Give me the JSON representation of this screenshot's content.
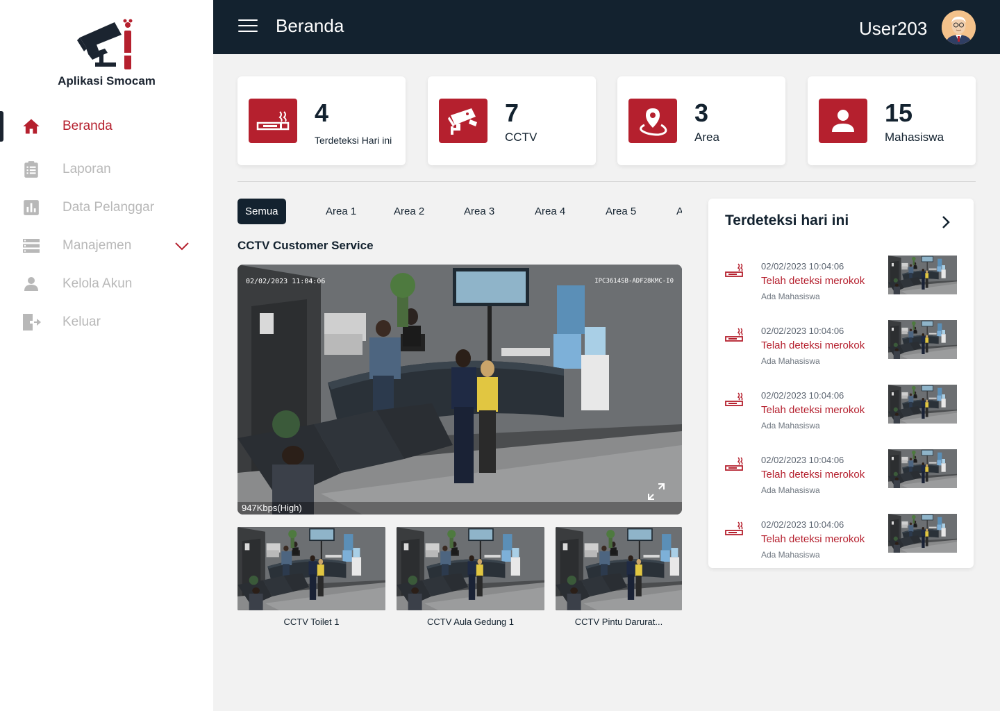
{
  "app": {
    "name": "Aplikasi Smocam"
  },
  "sidebar": {
    "items": [
      {
        "label": "Beranda",
        "icon": "home-icon",
        "active": true
      },
      {
        "label": "Laporan",
        "icon": "clipboard-icon"
      },
      {
        "label": "Data Pelanggar",
        "icon": "bar-chart-icon"
      },
      {
        "label": "Manajemen",
        "icon": "list-icon",
        "expandable": true
      },
      {
        "label": "Kelola Akun",
        "icon": "user-icon"
      },
      {
        "label": "Keluar",
        "icon": "logout-icon"
      }
    ]
  },
  "header": {
    "title": "Beranda",
    "username": "User203"
  },
  "stats": [
    {
      "value": "4",
      "label": "Terdeteksi Hari ini",
      "icon": "no-smoking-icon"
    },
    {
      "value": "7",
      "label": "CCTV",
      "icon": "cctv-icon"
    },
    {
      "value": "3",
      "label": "Area",
      "icon": "location-pin-icon"
    },
    {
      "value": "15",
      "label": "Mahasiswa",
      "icon": "person-icon"
    }
  ],
  "tabs": [
    "Semua",
    "Area 1",
    "Area 2",
    "Area 3",
    "Area 4",
    "Area 5",
    "A"
  ],
  "main_feed": {
    "title": "CCTV Customer Service",
    "timestamp": "02/02/2023  11:04:06",
    "device_id": "IPC3614SB-ADF28KMC-I0",
    "bitrate": "947Kbps(High)"
  },
  "thumbnails": [
    {
      "label": "CCTV Toilet 1"
    },
    {
      "label": "CCTV Aula Gedung 1"
    },
    {
      "label": "CCTV Pintu Darurat..."
    }
  ],
  "detections": {
    "title": "Terdeteksi hari ini",
    "items": [
      {
        "time": "02/02/2023  10:04:06",
        "message": "Telah deteksi merokok",
        "sub": "Ada Mahasiswa"
      },
      {
        "time": "02/02/2023  10:04:06",
        "message": "Telah deteksi merokok",
        "sub": "Ada Mahasiswa"
      },
      {
        "time": "02/02/2023  10:04:06",
        "message": "Telah deteksi merokok",
        "sub": "Ada Mahasiswa"
      },
      {
        "time": "02/02/2023  10:04:06",
        "message": "Telah deteksi merokok",
        "sub": "Ada Mahasiswa"
      },
      {
        "time": "02/02/2023  10:04:06",
        "message": "Telah deteksi merokok",
        "sub": "Ada Mahasiswa"
      }
    ]
  },
  "colors": {
    "accent": "#b5202e",
    "navy": "#13222f",
    "muted": "#b8b8b8"
  }
}
